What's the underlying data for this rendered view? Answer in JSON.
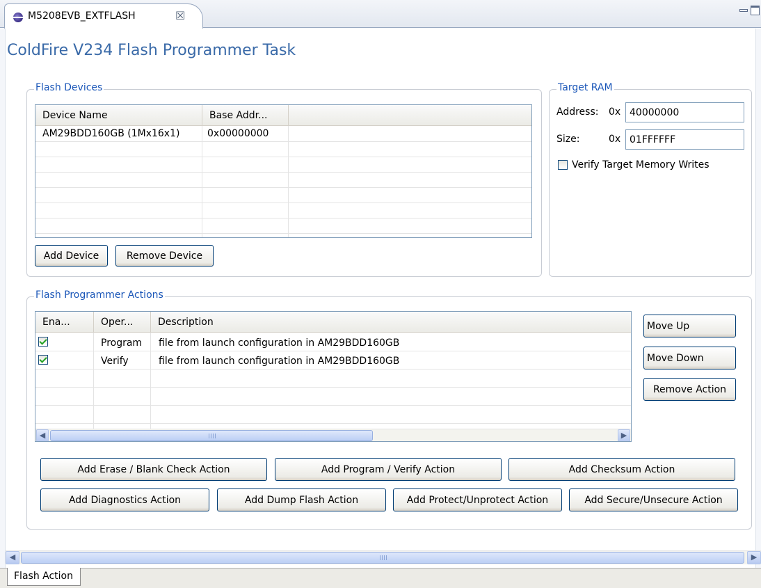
{
  "editor_tab": {
    "title": "M5208EVB_EXTFLASH",
    "close_glyph": "☒"
  },
  "page_title": "ColdFire V234 Flash Programmer Task",
  "flash_devices": {
    "group_title": "Flash Devices",
    "columns": [
      "Device Name",
      "Base Addr..."
    ],
    "rows": [
      {
        "device_name": "AM29BDD160GB (1Mx16x1)",
        "base_addr": "0x00000000"
      }
    ],
    "add_device_label": "Add Device",
    "remove_device_label": "Remove Device"
  },
  "target_ram": {
    "group_title": "Target RAM",
    "address_label": "Address:",
    "address_prefix": "0x",
    "address_value": "40000000",
    "size_label": "Size:",
    "size_prefix": "0x",
    "size_value": "01FFFFFF",
    "verify_label": "Verify Target Memory Writes",
    "verify_checked": false
  },
  "actions": {
    "group_title": "Flash Programmer Actions",
    "columns": [
      "Ena...",
      "Oper...",
      "Description"
    ],
    "rows": [
      {
        "enabled": true,
        "operation": "Program",
        "description": "file from launch configuration in AM29BDD160GB"
      },
      {
        "enabled": true,
        "operation": "Verify",
        "description": "file from launch configuration in AM29BDD160GB"
      }
    ],
    "move_up_label": "Move Up",
    "move_down_label": "Move Down",
    "remove_action_label": "Remove Action",
    "add_buttons": {
      "erase_blank_check": "Add Erase / Blank Check Action",
      "program_verify": "Add Program / Verify Action",
      "checksum": "Add Checksum Action",
      "diagnostics": "Add Diagnostics Action",
      "dump_flash": "Add Dump Flash Action",
      "protect_unprotect": "Add Protect/Unprotect Action",
      "secure_unsecure": "Add Secure/Unsecure Action"
    }
  },
  "page_tabs": [
    "Flash Action"
  ],
  "colors": {
    "title_blue": "#3a6aa8",
    "group_title_blue": "#1a56b8",
    "checkbox_check_green": "#21a121",
    "button_border": "#003c74"
  }
}
